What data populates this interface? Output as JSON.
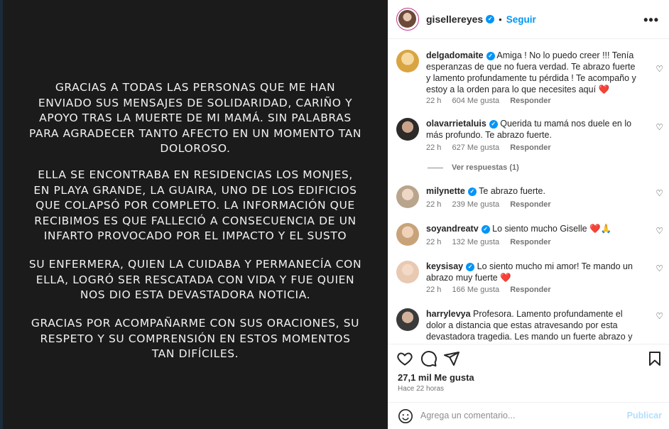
{
  "story": {
    "paragraphs": [
      "GRACIAS A TODAS LAS PERSONAS QUE ME HAN ENVIADO SUS MENSAJES DE SOLIDARIDAD, CARIÑO Y APOYO TRAS LA MUERTE DE MI MAMÁ. SIN PALABRAS PARA AGRADECER TANTO AFECTO EN UN MOMENTO TAN DOLOROSO.",
      "ELLA SE ENCONTRABA EN RESIDENCIAS LOS MONJES, EN PLAYA GRANDE, LA GUAIRA, UNO DE LOS EDIFICIOS QUE COLAPSÓ POR COMPLETO. LA INFORMACIÓN QUE RECIBIMOS ES QUE FALLECIÓ A CONSECUENCIA DE UN INFARTO PROVOCADO POR EL IMPACTO Y EL SUSTO",
      "SU ENFERMERA, QUIEN LA CUIDABA Y PERMANECÍA CON ELLA, LOGRÓ SER RESCATADA CON VIDA Y FUE QUIEN NOS DIO ESTA DEVASTADORA NOTICIA.",
      "GRACIAS POR ACOMPAÑARME CON SUS ORACIONES, SU RESPETO Y SU COMPRENSIÓN EN ESTOS MOMENTOS TAN DIFÍCILES."
    ]
  },
  "header": {
    "username": "gisellereyes",
    "dot": "•",
    "follow_label": "Seguir",
    "more": "•••"
  },
  "comments": [
    {
      "user": "delgadomaite",
      "text": "Amiga ! No lo puedo creer !!! Tenía esperanzas de que no fuera verdad. Te abrazo fuerte y lamento profundamente tu pérdida ! Te acompaño y estoy a la orden para lo que necesites aquí",
      "emoji": "❤️",
      "time": "22 h",
      "likes": "604 Me gusta",
      "reply": "Responder"
    },
    {
      "user": "olavarrietaluis",
      "text": "Querida tu mamá nos duele en lo más profundo. Te abrazo fuerte.",
      "emoji": "",
      "time": "22 h",
      "likes": "627 Me gusta",
      "reply": "Responder"
    },
    {
      "user": "milynette",
      "text": "Te abrazo fuerte.",
      "emoji": "",
      "time": "22 h",
      "likes": "239 Me gusta",
      "reply": "Responder"
    },
    {
      "user": "soyandreatv",
      "text": "Lo siento mucho Giselle",
      "emoji": "❤️🙏",
      "time": "22 h",
      "likes": "132 Me gusta",
      "reply": "Responder"
    },
    {
      "user": "keysisay",
      "text": "Lo siento mucho mi amor! Te mando un abrazo muy fuerte",
      "emoji": "❤️",
      "time": "22 h",
      "likes": "166 Me gusta",
      "reply": "Responder"
    },
    {
      "user": "harrylevya",
      "text": "Profesora. Lamento profundamente el dolor a distancia que estas atravesando por esta devastadora tragedia. Les mando un fuerte abrazo y las acompaño en el duelo que",
      "emoji": "",
      "time": "",
      "likes": "",
      "reply": ""
    }
  ],
  "view_replies": "Ver respuestas (1)",
  "likes_count": "27,1 mil Me gusta",
  "post_time": "Hace 22 horas",
  "add_comment": {
    "placeholder": "Agrega un comentario...",
    "publish": "Publicar"
  },
  "colors": {
    "accent": "#0095f6",
    "media_bg": "#1b1b1b",
    "publish_disabled": "#b2dffc",
    "heart": "#e0102b"
  }
}
